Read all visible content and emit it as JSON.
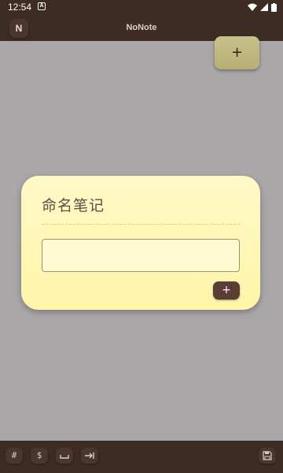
{
  "status_bar": {
    "time": "12:54",
    "notification_icon": "A"
  },
  "app_bar": {
    "logo_letter": "N",
    "title": "NoNote"
  },
  "fab": {
    "label": "+"
  },
  "dialog": {
    "title": "命名笔记",
    "input_value": "",
    "confirm_label": "+"
  },
  "toolbar": {
    "hash_label": "#",
    "dollar_label": "$",
    "space_icon": "space-icon",
    "tab_icon": "tab-icon",
    "save_icon": "save-icon"
  },
  "colors": {
    "bar": "#3e2b24",
    "backdrop": "#a9a7a8",
    "dialog": "#fff6b5",
    "fab": "#c1b97f",
    "confirm": "#5a3d35"
  }
}
